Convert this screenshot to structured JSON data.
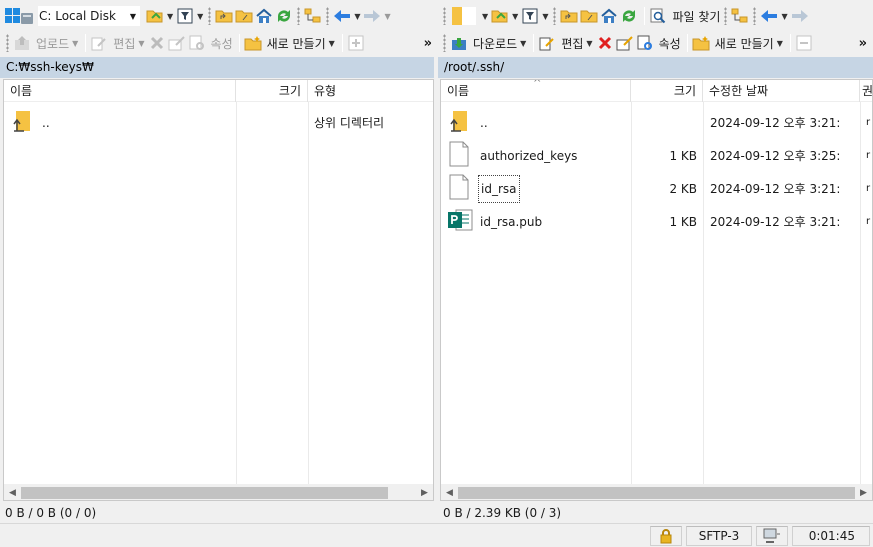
{
  "left_toolbar1": {
    "drive_label": "C: Local Disk"
  },
  "left_toolbar2": {
    "upload": "업로드",
    "edit": "편집",
    "props": "속성",
    "new": "새로 만들기",
    "more": "»"
  },
  "right_toolbar1": {
    "find": "파일 찾기"
  },
  "right_toolbar2": {
    "download": "다운로드",
    "edit": "편집",
    "props": "속성",
    "new": "새로 만들기",
    "more": "»"
  },
  "left_panel": {
    "path": "C:₩ssh-keys₩",
    "columns": {
      "name": "이름",
      "size": "크기",
      "type": "유형"
    },
    "rows": [
      {
        "name": "..",
        "size": "",
        "type": "상위 디렉터리"
      }
    ],
    "info": "0 B / 0 B (0 / 0)"
  },
  "right_panel": {
    "path": "/root/.ssh/",
    "columns": {
      "name": "이름",
      "size": "크기",
      "modified": "수정한 날짜",
      "extra": "권"
    },
    "rows": [
      {
        "name": "..",
        "size": "",
        "modified": "2024-09-12 오후 3:21:",
        "extra": "r"
      },
      {
        "name": "authorized_keys",
        "size": "1 KB",
        "modified": "2024-09-12 오후 3:25:",
        "extra": "r"
      },
      {
        "name": "id_rsa",
        "size": "2 KB",
        "modified": "2024-09-12 오후 3:21:",
        "extra": "r"
      },
      {
        "name": "id_rsa.pub",
        "size": "1 KB",
        "modified": "2024-09-12 오후 3:21:",
        "extra": "r"
      }
    ],
    "info": "0 B / 2.39 KB (0 / 3)"
  },
  "status_bar": {
    "protocol": "SFTP-3",
    "elapsed": "0:01:45"
  },
  "colors": {
    "path_bar": "#c6d5e4",
    "folder": "#f5c242",
    "refresh": "#3aa640",
    "arrow": "#2c7de0",
    "delete": "#e02020",
    "publisher": "#077568"
  },
  "icons": [
    "windows-drive-icon",
    "open-folder-icon",
    "filter-icon",
    "parent-folder-icon",
    "root-folder-icon",
    "home-icon",
    "refresh-icon",
    "sync-tree-icon",
    "back-arrow-icon",
    "forward-arrow-icon",
    "upload-icon",
    "download-icon",
    "edit-icon",
    "delete-icon",
    "rename-icon",
    "properties-icon",
    "new-folder-icon",
    "find-files-icon",
    "lock-icon",
    "network-icon"
  ]
}
